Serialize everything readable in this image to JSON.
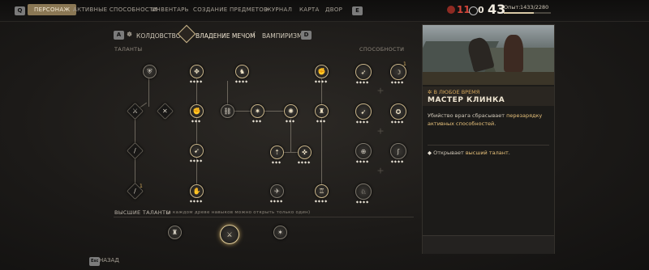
{
  "nav": {
    "left_key": "Q",
    "right_key": "E",
    "tabs": [
      "ПЕРСОНАЖ",
      "АКТИВНЫЕ СПОСОБНОСТИ",
      "ИНВЕНТАРЬ",
      "СОЗДАНИЕ ПРЕДМЕТОВ",
      "ЖУРНАЛ",
      "КАРТА",
      "ДВОР"
    ]
  },
  "hud": {
    "health": "11",
    "points": "0",
    "level": "43",
    "xp_label": "Опыт:",
    "xp_value": "1433/2280"
  },
  "subtabs": {
    "left_key": "A",
    "right_key": "D",
    "items": [
      "КОЛДОВСТВО",
      "ВЛАДЕНИЕ МЕЧОМ",
      "ВАМПИРИЗМ"
    ],
    "active": "ВЛАДЕНИЕ МЕЧОМ"
  },
  "labels": {
    "talents": "ТАЛАНТЫ",
    "abilities": "СПОСОБНОСТИ",
    "high_talents": "ВЫСШИЕ ТАЛАНТЫ",
    "high_talents_note": "(в каждом древе навыков можно открыть только один)"
  },
  "detail": {
    "when": "В ЛЮБОЕ ВРЕМЯ",
    "title": "МАСТЕР КЛИНКА",
    "desc_part1": "Убийство врага сбрасывает ",
    "desc_highlight": "перезарядку активных способностей",
    "desc_part2": ".",
    "bullet_part1": "Открывает ",
    "bullet_highlight": "высший талант",
    "bullet_part2": "."
  },
  "footer": {
    "back_key": "Esc",
    "back_label": "НАЗАД"
  },
  "tree": {
    "rank_labels": [
      "1",
      "1"
    ],
    "icons": [
      "shield-icon",
      "sword-icon",
      "claw-icon",
      "fist-icon",
      "cross-swords-icon",
      "blade-icon",
      "wolf-icon",
      "spark-icon",
      "chain-icon",
      "dash-icon",
      "compass-icon",
      "arrow-icon",
      "gauntlet-icon",
      "strike-icon",
      "crest-icon",
      "eagle-icon",
      "helm-icon"
    ]
  },
  "colors": {
    "accent": "#8a7754",
    "health": "#c0392b",
    "highlight": "#e6c07a"
  }
}
